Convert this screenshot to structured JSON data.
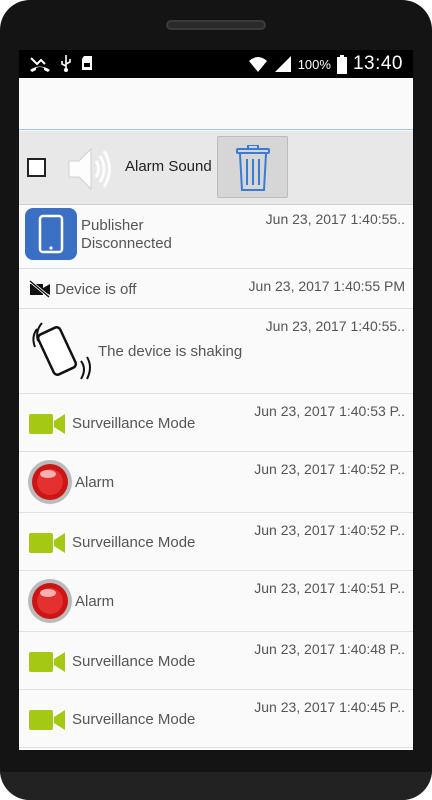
{
  "status_bar": {
    "battery_percent": "100%",
    "time": "13:40",
    "icons": [
      "missed-call-icon",
      "usb-icon",
      "sd-card-icon",
      "wifi-icon",
      "signal-icon",
      "battery-icon"
    ]
  },
  "filter": {
    "label": "Alarm Sound",
    "checked": false
  },
  "events": [
    {
      "type": "publisher",
      "label_line1": "Publisher",
      "label_line2": "Disconnected",
      "time": "Jun 23, 2017 1:40:55.."
    },
    {
      "type": "device-off",
      "label_line1": "Device is off",
      "label_line2": "",
      "time": "Jun 23, 2017 1:40:55 PM"
    },
    {
      "type": "shaking",
      "label_line1": "The device is shaking",
      "label_line2": "",
      "time": "Jun 23, 2017 1:40:55.."
    },
    {
      "type": "surveillance",
      "label_line1": "Surveillance Mode",
      "label_line2": "",
      "time": "Jun 23, 2017 1:40:53 P.."
    },
    {
      "type": "alarm",
      "label_line1": "Alarm",
      "label_line2": "",
      "time": "Jun 23, 2017 1:40:52 P.."
    },
    {
      "type": "surveillance",
      "label_line1": "Surveillance Mode",
      "label_line2": "",
      "time": "Jun 23, 2017 1:40:52 P.."
    },
    {
      "type": "alarm",
      "label_line1": "Alarm",
      "label_line2": "",
      "time": "Jun 23, 2017 1:40:51 P.."
    },
    {
      "type": "surveillance",
      "label_line1": "Surveillance Mode",
      "label_line2": "",
      "time": "Jun 23, 2017 1:40:48 P.."
    },
    {
      "type": "surveillance",
      "label_line1": "Surveillance Mode",
      "label_line2": "",
      "time": "Jun 23, 2017 1:40:45 P.."
    }
  ],
  "colors": {
    "accent_blue": "#3a7bd5",
    "surveillance_green": "#a4c813",
    "alarm_red": "#e01b1b"
  }
}
